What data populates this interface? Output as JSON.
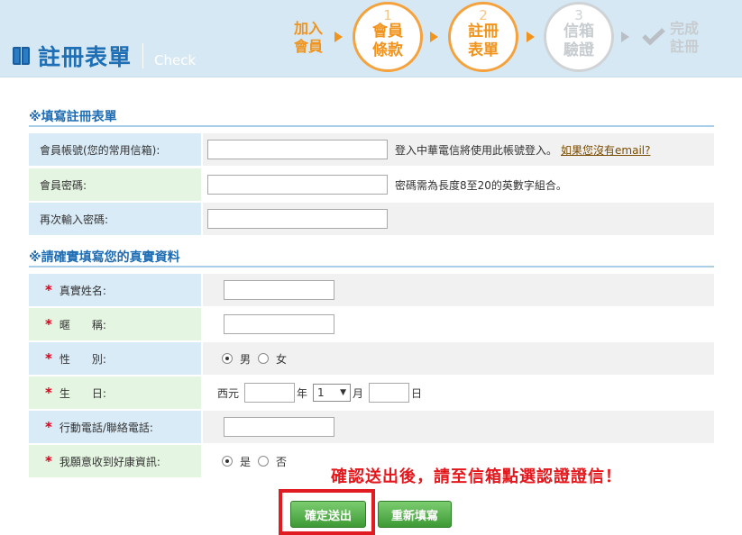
{
  "header": {
    "title": "註冊表單",
    "subtitle": "Check",
    "steps": [
      {
        "label_lines": [
          "加入",
          "會員"
        ],
        "number": "",
        "state": "active"
      },
      {
        "label_lines": [
          "會員",
          "條款"
        ],
        "number": "1",
        "state": "active"
      },
      {
        "label_lines": [
          "註冊",
          "表單"
        ],
        "number": "2",
        "state": "active"
      },
      {
        "label_lines": [
          "信箱",
          "驗證"
        ],
        "number": "3",
        "state": "inactive"
      },
      {
        "label_lines": [
          "完成",
          "註冊"
        ],
        "number": "",
        "state": "inactive"
      }
    ]
  },
  "section1": {
    "title": "※填寫註冊表單",
    "account_label": "會員帳號(您的常用信箱):",
    "account_value": "",
    "account_hint": "登入中華電信將使用此帳號登入。",
    "account_link": "如果您沒有email?",
    "password_label": "會員密碼:",
    "password_value": "",
    "password_hint": "密碼需為長度8至20的英數字組合。",
    "password2_label": "再次輸入密碼:",
    "password2_value": ""
  },
  "section2": {
    "title": "※請確實填寫您的真實資料",
    "required_mark": "*",
    "name_label": "真實姓名:",
    "name_value": "",
    "nickname_label": "暱　　稱:",
    "nickname_value": "",
    "gender_label": "性　　別:",
    "gender_options": [
      "男",
      "女"
    ],
    "gender_selected": "男",
    "birthday_label": "生　　日:",
    "birthday_era": "西元",
    "birthday_year_unit": "年",
    "birthday_month_value": "1",
    "birthday_month_unit": "月",
    "birthday_day_unit": "日",
    "phone_label": "行動電話/聯絡電話:",
    "phone_value": "",
    "subscribe_label": "我願意收到好康資訊:",
    "subscribe_options": [
      "是",
      "否"
    ],
    "subscribe_selected": "是"
  },
  "notice": "確認送出後，請至信箱點選認證證信！",
  "buttons": {
    "submit": "確定送出",
    "reset": "重新填寫"
  },
  "colors": {
    "accent_orange": "#f0941e",
    "brand_blue": "#1e6fb6",
    "button_green": "#3d9a35",
    "notice_red": "#e3171c"
  }
}
